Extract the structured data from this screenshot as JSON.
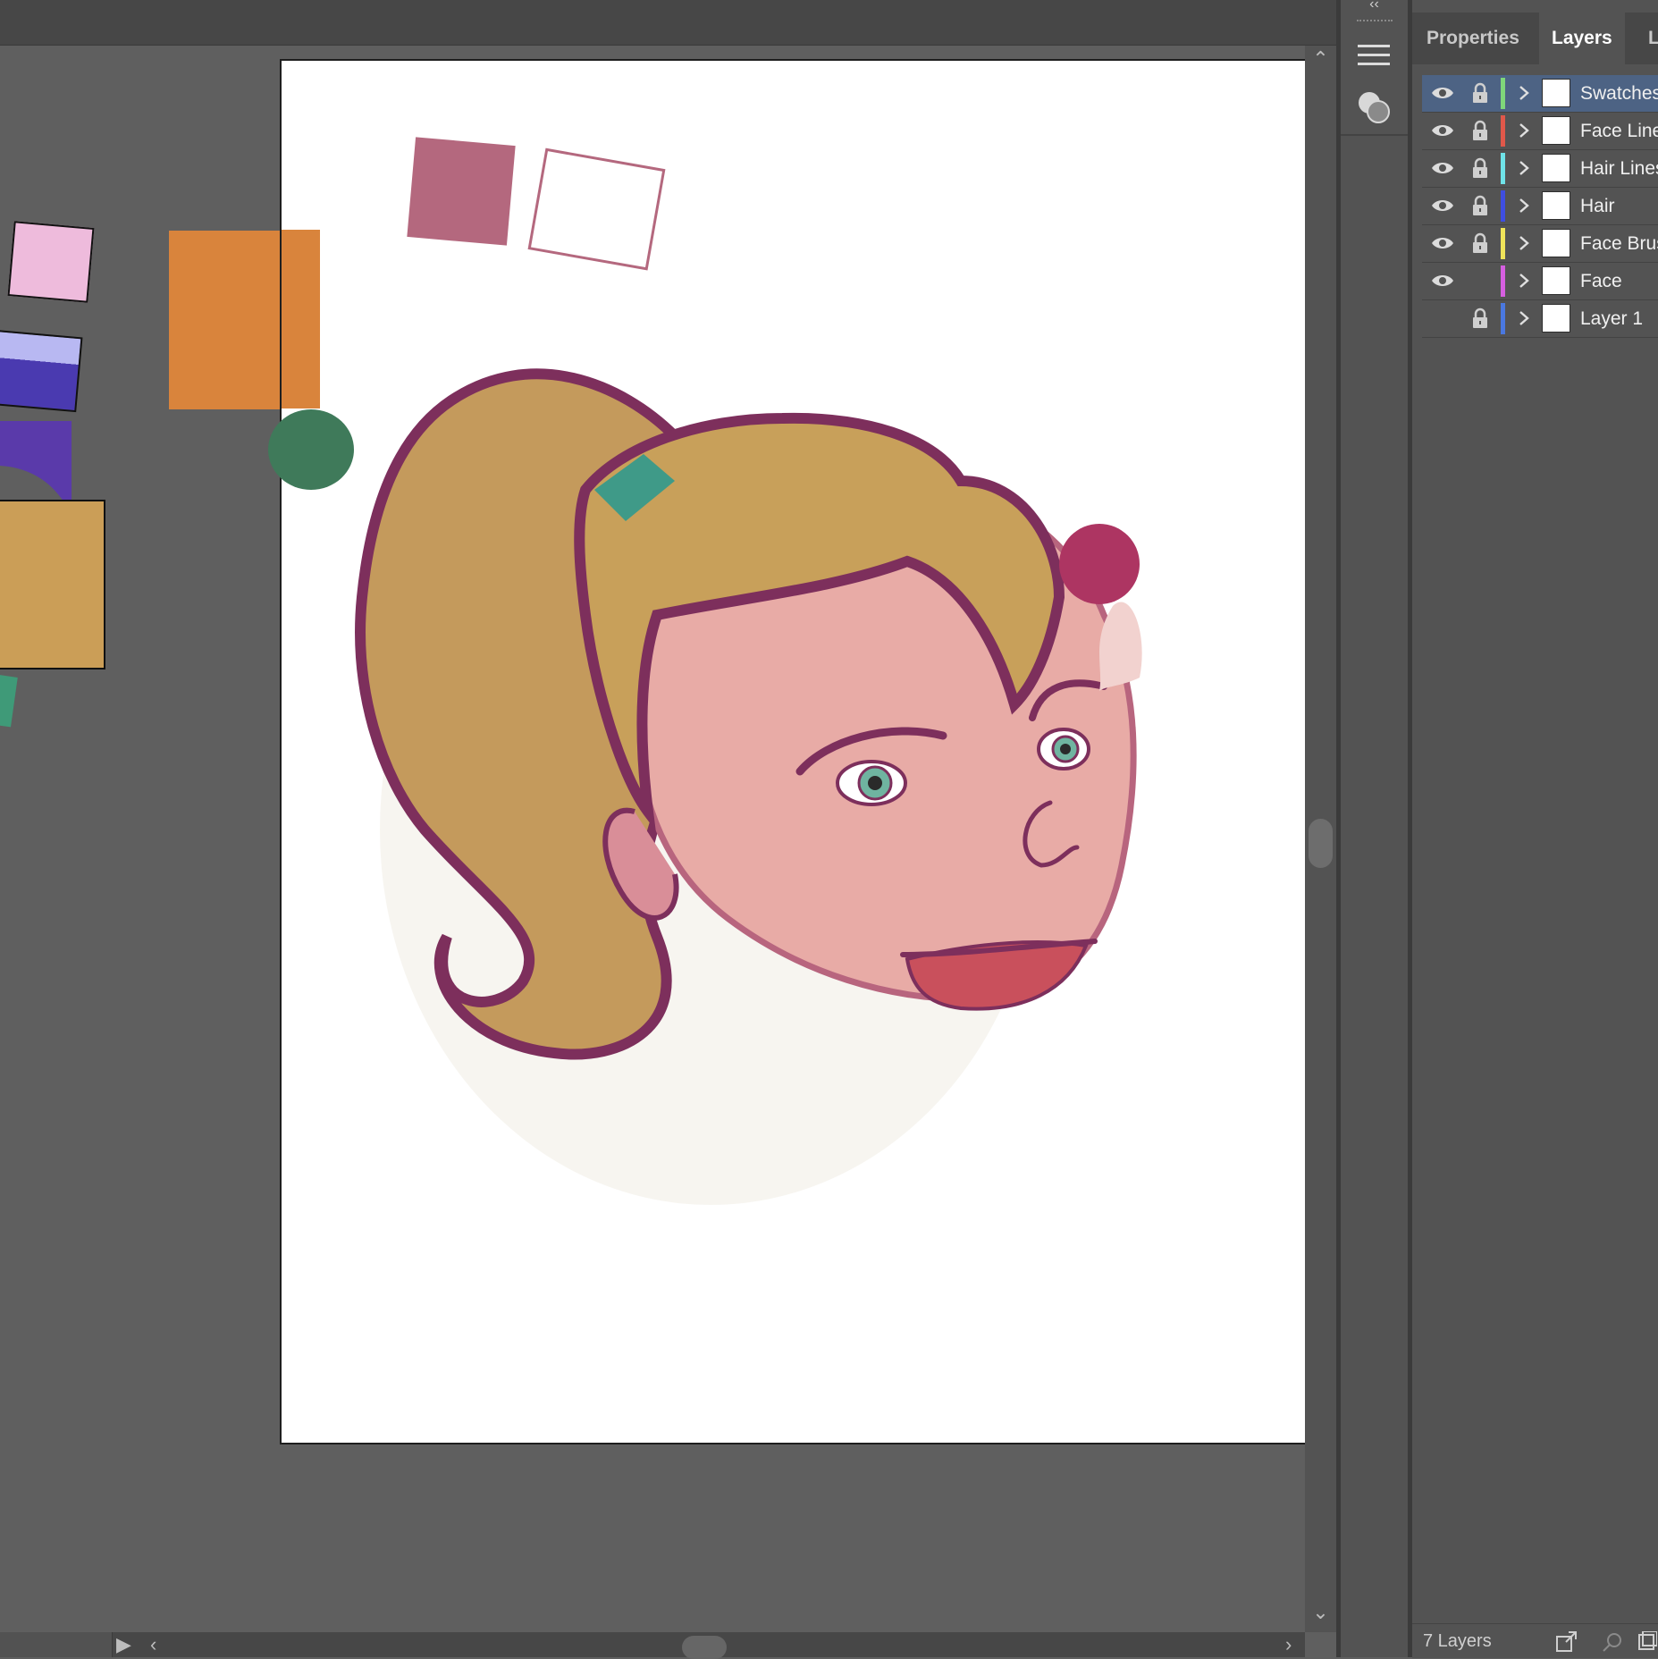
{
  "panel": {
    "tabs": [
      {
        "label": "Properties"
      },
      {
        "label": "Layers"
      },
      {
        "label": "Li"
      }
    ],
    "active_tab": "Layers"
  },
  "layers": [
    {
      "name": "Swatches",
      "visible": true,
      "locked": true,
      "color": "#7fd67a",
      "selected": true
    },
    {
      "name": "Face Lines",
      "visible": true,
      "locked": true,
      "color": "#e0584a",
      "selected": false
    },
    {
      "name": "Hair Lines",
      "visible": true,
      "locked": true,
      "color": "#6fe3e8",
      "selected": false
    },
    {
      "name": "Hair",
      "visible": true,
      "locked": true,
      "color": "#3f4ee0",
      "selected": false
    },
    {
      "name": "Face Brush",
      "visible": true,
      "locked": true,
      "color": "#f0e45a",
      "selected": false
    },
    {
      "name": "Face",
      "visible": true,
      "locked": false,
      "color": "#d65fe0",
      "selected": false
    },
    {
      "name": "Layer 1",
      "visible": false,
      "locked": true,
      "color": "#4a78e0",
      "selected": false
    }
  ],
  "footer": {
    "layer_count": "7 Layers"
  },
  "swatch_colors": {
    "mauve": "#b4687e",
    "orange": "#d9843c",
    "green": "#3f7a5a",
    "crimson": "#ad3562",
    "pink": "#eebbdc",
    "tan": "#cb9e57",
    "outline": "#7d2f5c"
  }
}
